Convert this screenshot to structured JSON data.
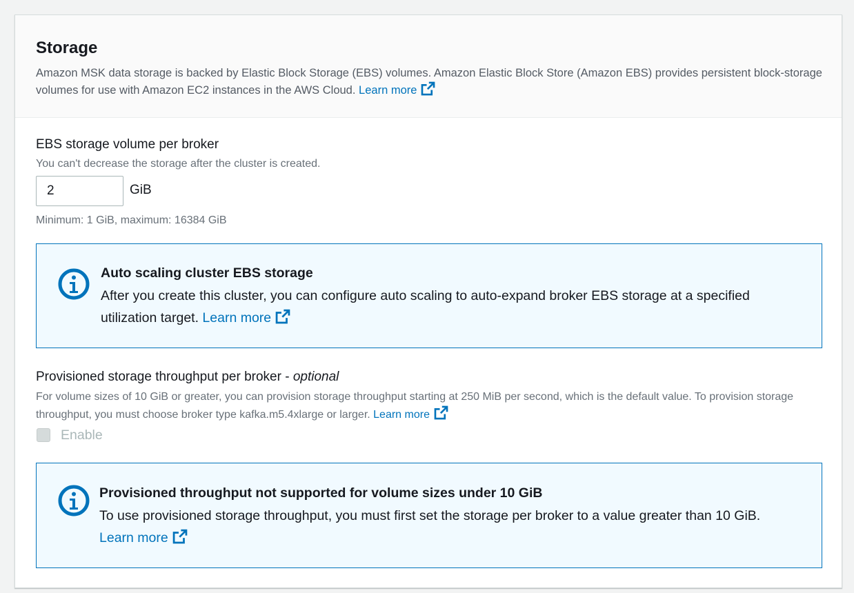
{
  "storage": {
    "title": "Storage",
    "description": "Amazon MSK data storage is backed by Elastic Block Storage (EBS) volumes. Amazon Elastic Block Store (Amazon EBS) provides persistent block-storage volumes for use with Amazon EC2 instances in the AWS Cloud.",
    "learn_more": "Learn more"
  },
  "ebs_volume": {
    "label": "EBS storage volume per broker",
    "description": "You can't decrease the storage after the cluster is created.",
    "value": "2",
    "unit": "GiB",
    "constraint": "Minimum: 1 GiB, maximum: 16384 GiB"
  },
  "autoscaling_alert": {
    "title": "Auto scaling cluster EBS storage",
    "body": "After you create this cluster, you can configure auto scaling to auto-expand broker EBS storage at a specified utilization target.",
    "learn_more": "Learn more"
  },
  "throughput": {
    "label": "Provisioned storage throughput per broker - ",
    "label_optional": "optional",
    "description": "For volume sizes of 10 GiB or greater, you can provision storage throughput starting at 250 MiB per second, which is the default value. To provision storage throughput, you must choose broker type kafka.m5.4xlarge or larger.",
    "learn_more": "Learn more",
    "checkbox_label": "Enable",
    "checkbox_checked": false,
    "checkbox_disabled": true
  },
  "throughput_alert": {
    "title": "Provisioned throughput not supported for volume sizes under 10 GiB",
    "body": "To use provisioned storage throughput, you must first set the storage per broker to a value greater than 10 GiB.",
    "learn_more": "Learn more"
  },
  "colors": {
    "link": "#0073bb",
    "alert_border": "#0073bb",
    "alert_bg": "#f1faff"
  },
  "icons": [
    "external-link-icon",
    "info-icon"
  ]
}
